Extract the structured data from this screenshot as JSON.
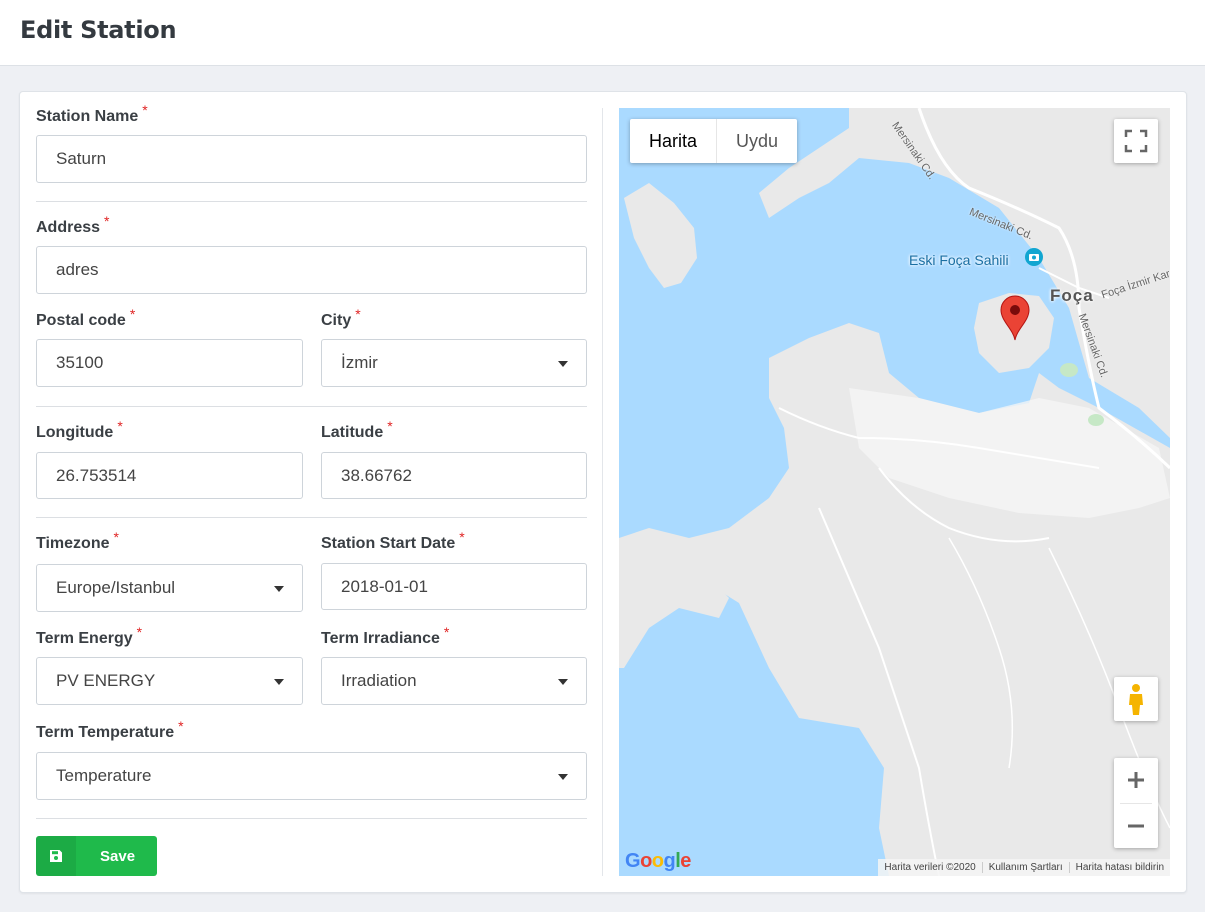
{
  "page": {
    "title": "Edit Station"
  },
  "form": {
    "station_name": {
      "label": "Station Name",
      "value": "Saturn"
    },
    "address": {
      "label": "Address",
      "value": "adres"
    },
    "postal_code": {
      "label": "Postal code",
      "value": "35100"
    },
    "city": {
      "label": "City",
      "value": "İzmir"
    },
    "longitude": {
      "label": "Longitude",
      "value": "26.753514"
    },
    "latitude": {
      "label": "Latitude",
      "value": "38.66762"
    },
    "timezone": {
      "label": "Timezone",
      "value": "Europe/Istanbul"
    },
    "start_date": {
      "label": "Station Start Date",
      "value": "2018-01-01"
    },
    "term_energy": {
      "label": "Term Energy",
      "value": "PV ENERGY"
    },
    "term_irradiance": {
      "label": "Term Irradiance",
      "value": "Irradiation"
    },
    "term_temperature": {
      "label": "Term Temperature",
      "value": "Temperature"
    },
    "required_mark": "*",
    "save_label": "Save",
    "save_icon": "floppy-disk-icon"
  },
  "map": {
    "type_options": [
      "Harita",
      "Uydu"
    ],
    "active_type": "Harita",
    "labels": {
      "place": "Eski Foça Sahili",
      "city": "Foça",
      "road1": "Mersinaki Cd.",
      "road2": "Mersinaki Cd.",
      "road3": "Foça İzmir Karay",
      "road4": "Mersinaki Cd."
    },
    "footer": [
      "Harita verileri ©2020",
      "Kullanım Şartları",
      "Harita hatası bildirin"
    ],
    "logo": "Google",
    "colors": {
      "water": "#aadaff",
      "land": "#e9e9e9",
      "marker": "#ea4335"
    }
  }
}
